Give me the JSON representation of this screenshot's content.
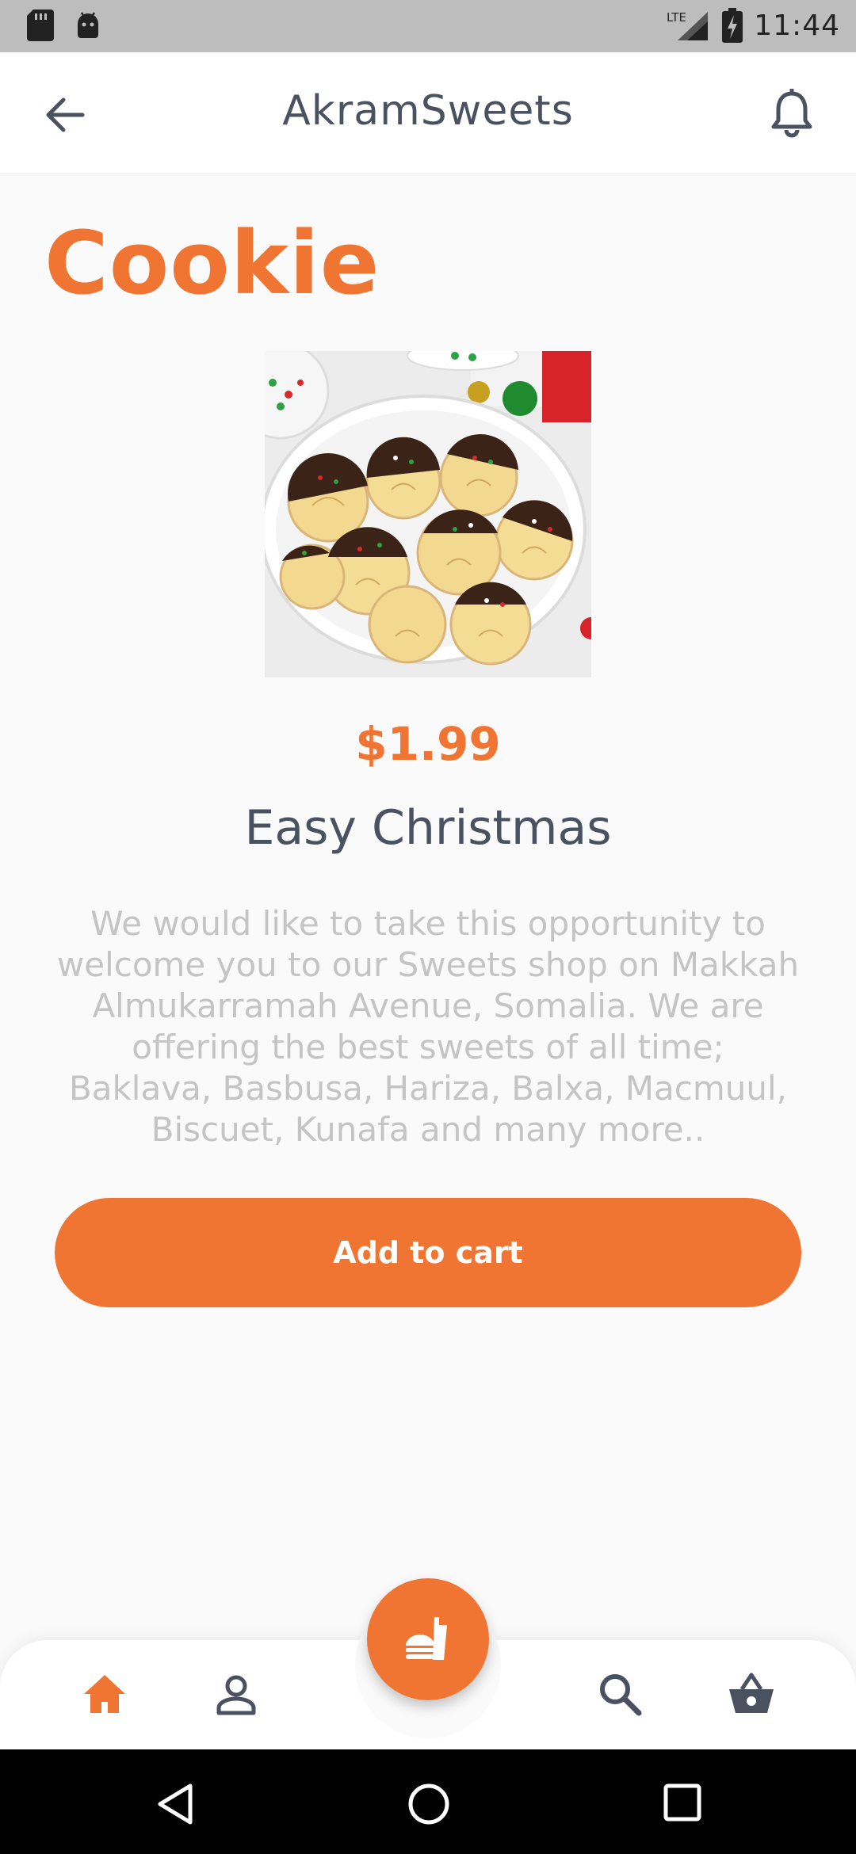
{
  "status_bar": {
    "time": "11:44",
    "network": "LTE",
    "icons": [
      "sd-card-icon",
      "android-icon",
      "signal-icon",
      "battery-charging-icon"
    ]
  },
  "app_bar": {
    "title": "AkramSweets",
    "icons": [
      "arrow-back-icon",
      "bell-icon"
    ]
  },
  "product": {
    "category": "Cookie",
    "image_alt": "Chocolate-dipped butter cookies with sprinkles on a white plate",
    "price": "$1.99",
    "name": "Easy Christmas",
    "description": "We would like to take this opportunity to welcome you to our Sweets shop on Makkah Almukarramah Avenue, Somalia. We are offering the best sweets of all time; Baklava, Basbusa, Hariza, Balxa, Macmuul, Biscuet, Kunafa and many more..",
    "add_to_cart_label": "Add to cart"
  },
  "bottom_nav": {
    "items": [
      {
        "icon": "home-icon",
        "active": true
      },
      {
        "icon": "person-icon",
        "active": false
      },
      {
        "icon": "fastfood-icon",
        "active": false
      },
      {
        "icon": "search-icon",
        "active": false
      },
      {
        "icon": "basket-icon",
        "active": false
      }
    ]
  },
  "colors": {
    "accent": "#f07532",
    "text_dark": "#4a5262",
    "text_muted": "#c4c4c4",
    "background": "#fafafa"
  }
}
